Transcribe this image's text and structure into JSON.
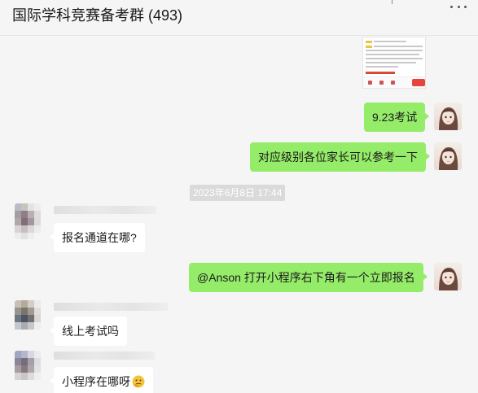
{
  "header": {
    "title": "国际学科竞赛备考群 (493)"
  },
  "messages": [
    {
      "side": "me",
      "type": "image",
      "label": "image-thumbnail"
    },
    {
      "side": "me",
      "type": "text",
      "text": "9.23考试"
    },
    {
      "side": "me",
      "type": "text",
      "text": "对应级别各位家长可以参考一下"
    },
    {
      "type": "time",
      "text": "2023年6月8日 17:44"
    },
    {
      "side": "other",
      "type": "text",
      "text": "报名通道在哪?"
    },
    {
      "side": "me",
      "type": "text",
      "text": "@Anson 打开小程序右下角有一个立即报名"
    },
    {
      "side": "other",
      "type": "text",
      "text": "线上考试吗"
    },
    {
      "side": "other",
      "type": "text",
      "text": "小程序在哪呀",
      "emoji": "thinking-emoji"
    }
  ],
  "colors": {
    "bg": "#f5f5f5",
    "my_bubble": "#95ec69",
    "other_bubble": "#ffffff",
    "timestamp_bg": "#dadada"
  }
}
